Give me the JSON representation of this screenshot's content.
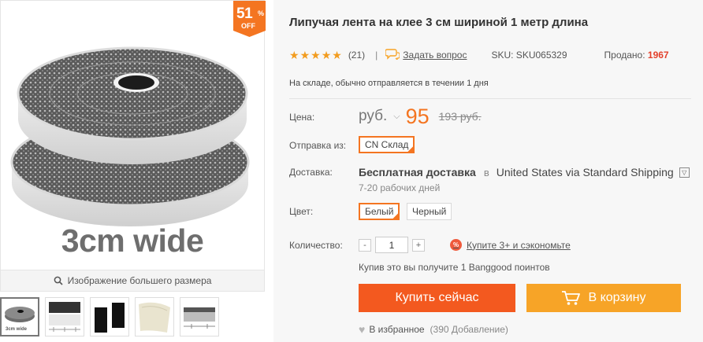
{
  "badge": {
    "percent": "51",
    "percent_sign": "%",
    "off_label": "OFF"
  },
  "gallery": {
    "image_caption": "3cm wide",
    "zoom_label": "Изображение большего размера",
    "thumbnail_1_caption": "3cm wide"
  },
  "product": {
    "title": "Липучая лента на клее 3 см шириной 1 метр длина",
    "rating_stars": 5,
    "reviews": "(21)",
    "ask_label": "Задать вопрос",
    "sku": "SKU: SKU065329",
    "sold_label": "Продано:",
    "sold_count": "1967",
    "stock_text": "На складе, обычно отправляется в течении 1 дня"
  },
  "price": {
    "label": "Цена:",
    "currency": "руб.",
    "value": "95",
    "old_value": "193 руб."
  },
  "ship_from": {
    "label": "Отправка из:",
    "selected": "CN Склад"
  },
  "delivery": {
    "label": "Доставка:",
    "free": "Бесплатная доставка",
    "in_word": "в",
    "method": "United States via Standard Shipping",
    "days": "7-20 рабочих дней"
  },
  "color": {
    "label": "Цвет:",
    "options": [
      "Белый",
      "Черный"
    ],
    "selected_index": 0
  },
  "quantity": {
    "label": "Количество:",
    "minus": "-",
    "value": "1",
    "plus": "+",
    "promo_badge": "%",
    "promo": "Купите 3+ и сэкономьте",
    "points": "Купив это вы получите 1 Banggood поинтов"
  },
  "actions": {
    "buy_now": "Купить сейчас",
    "add_to_cart": "В корзину",
    "wishlist": "В избранное",
    "wishlist_count": "(390 Добавление)"
  },
  "colors": {
    "accent": "#f47521",
    "buy_now": "#f3591f",
    "add_to_cart": "#f7a427",
    "sold": "#e3412c",
    "star": "#f29c1f"
  },
  "icons": [
    "magnifier-icon",
    "chat-bubble-icon",
    "chevron-down-icon",
    "star-icon",
    "percent-icon",
    "cart-icon",
    "heart-icon"
  ]
}
